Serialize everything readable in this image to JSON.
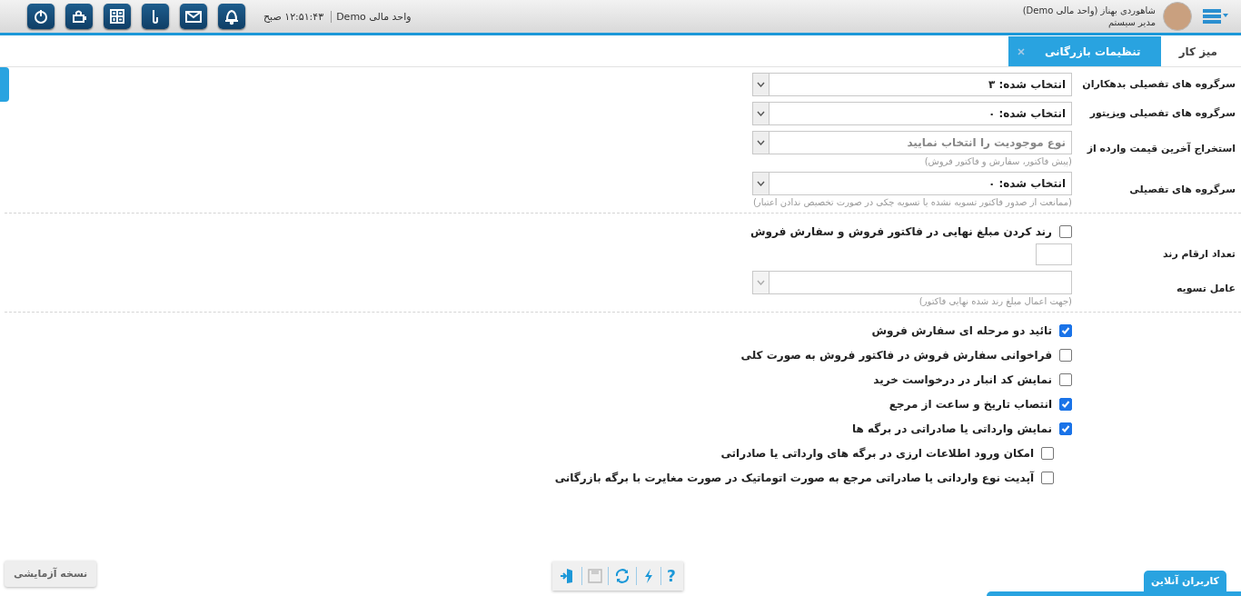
{
  "header": {
    "unit": "واحد مالی Demo",
    "time": "۱۲:۵۱:۴۳ صبح",
    "user_name": "شاهوردی بهناز (واحد مالی Demo)",
    "user_role": "مدیر سیستم"
  },
  "tabs": [
    {
      "label": "میز کار",
      "selected": false,
      "closable": false
    },
    {
      "label": "تنظیمات بازرگانی",
      "selected": true,
      "closable": true
    }
  ],
  "form_sections": [
    {
      "rows": [
        {
          "kind": "select",
          "label": "سرگروه های تفصیلی بدهکاران",
          "value": "انتخاب شده: ۳",
          "disabled": false
        },
        {
          "kind": "select",
          "label": "سرگروه های تفصیلی ویزیتور",
          "value": "انتخاب شده: ۰",
          "disabled": false
        },
        {
          "kind": "select",
          "label": "استخراج آخرین قیمت وارده از",
          "placeholder": "نوع موجودیت را انتخاب نمایید",
          "hint": "(پیش فاکتور، سفارش و فاکتور فروش)",
          "disabled": false
        },
        {
          "kind": "select",
          "label": "سرگروه های تفصیلی",
          "value": "انتخاب شده: ۰",
          "hint": "(ممانعت از صدور فاکتور تسویه نشده یا تسویه چکی در صورت تخصیص ندادن اعتبار)",
          "disabled": false
        }
      ]
    },
    {
      "rows": [
        {
          "kind": "checkbox",
          "text": "رند کردن مبلغ نهایی در فاکتور فروش و سفارش فروش",
          "checked": false
        },
        {
          "kind": "input",
          "label": "تعداد ارقام رند"
        },
        {
          "kind": "select",
          "label": "عامل تسویه",
          "hint": "(جهت اعمال مبلغ رند شده نهایی فاکتور)",
          "disabled": true
        }
      ]
    },
    {
      "rows": [
        {
          "kind": "checkbox",
          "text": "تائید دو مرحله ای سفارش فروش",
          "checked": true
        },
        {
          "kind": "checkbox",
          "text": "فراخوانی سفارش فروش در فاکتور فروش به صورت کلی",
          "checked": false
        },
        {
          "kind": "checkbox",
          "text": "نمایش کد انبار در درخواست خرید",
          "checked": false
        },
        {
          "kind": "checkbox",
          "text": "انتصاب تاریخ و ساعت از مرجع",
          "checked": true
        },
        {
          "kind": "checkbox",
          "text": "نمایش وارداتی یا صادراتی در برگه ها",
          "checked": true,
          "children": [
            {
              "text": "امکان ورود اطلاعات ارزی در برگه های وارداتی یا صادراتی",
              "checked": false
            },
            {
              "text": "آپدیت نوع وارداتی یا صادراتی مرجع به صورت اتوماتیک در صورت مغایرت با برگه بازرگانی",
              "checked": false
            }
          ]
        }
      ]
    }
  ],
  "footer": {
    "trial_badge": "نسخه آزمایشی",
    "help_glyph": "?",
    "online_users": "کاربران آنلاین"
  }
}
